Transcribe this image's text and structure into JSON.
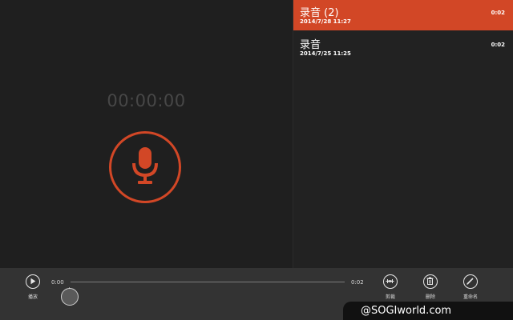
{
  "recorder": {
    "timer": "00:00:00"
  },
  "recordings": [
    {
      "name": "录音",
      "count": "(2)",
      "date": "2014/7/28 11:27",
      "duration": "0:02",
      "selected": true
    },
    {
      "name": "录音",
      "count": "",
      "date": "2014/7/25 11:25",
      "duration": "0:02",
      "selected": false
    }
  ],
  "playback": {
    "play_label": "播放",
    "time_start": "0:00",
    "time_end": "0:02",
    "position_fraction": 0.0
  },
  "commands": {
    "trim_label": "剪裁",
    "delete_label": "删除",
    "rename_label": "重命名"
  },
  "watermark": "@SOGIworld.com",
  "colors": {
    "accent": "#d24726",
    "background": "#1f1f1f",
    "appbar": "#333333"
  },
  "icons": [
    "microphone-icon",
    "play-icon",
    "trim-icon",
    "delete-icon",
    "rename-icon"
  ]
}
